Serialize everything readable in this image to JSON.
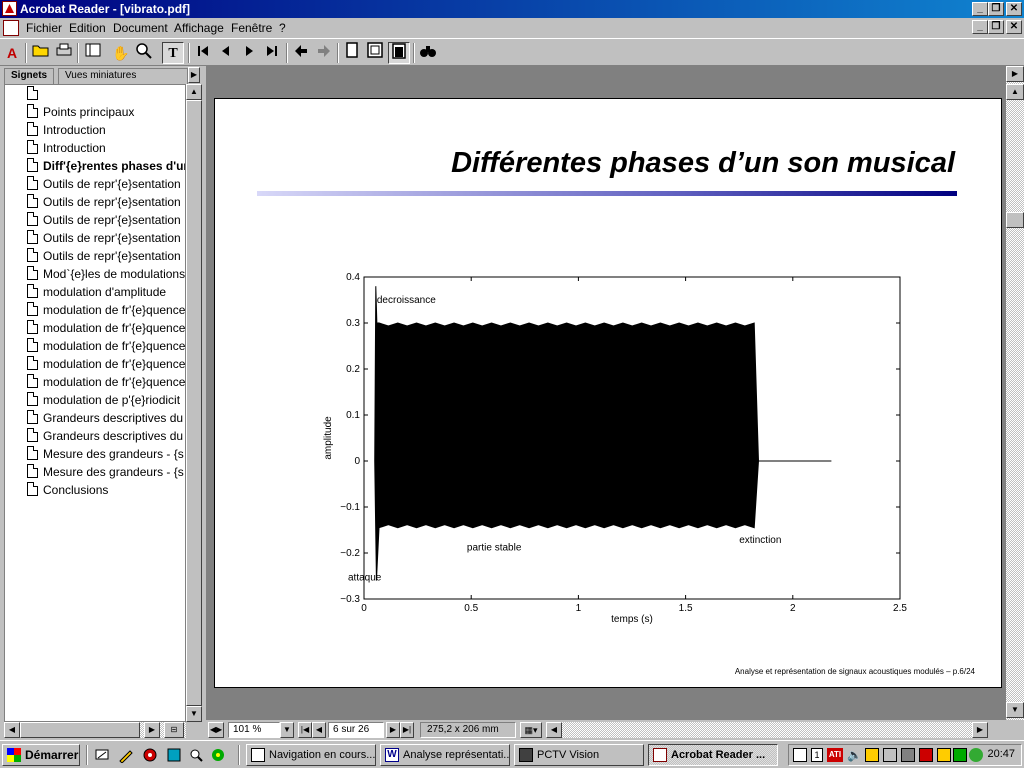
{
  "window": {
    "title": "Acrobat Reader - [vibrato.pdf]",
    "minimize": "_",
    "restore": "❐",
    "close": "✕"
  },
  "menu": {
    "items": [
      "Fichier",
      "Edition",
      "Document",
      "Affichage",
      "Fenêtre",
      "?"
    ]
  },
  "toolbar": {
    "icons": [
      "acrobat-icon",
      "open-icon",
      "print-icon",
      "bookmark-pane-icon",
      "hand-icon",
      "zoom-icon",
      "text-select-icon",
      "first-page-icon",
      "prev-page-icon",
      "next-page-icon",
      "last-page-icon",
      "go-back-icon",
      "go-forward-icon",
      "actual-size-icon",
      "fit-page-icon",
      "fit-width-icon",
      "find-icon"
    ]
  },
  "sidebar": {
    "tabs": [
      "Signets",
      "Vues miniatures"
    ],
    "bookmarks": [
      "",
      "Points principaux",
      "Introduction",
      "Introduction",
      "Diff'{e}rentes phases d'un",
      "Outils de repr'{e}sentation",
      "Outils de repr'{e}sentation",
      "Outils de repr'{e}sentation",
      "Outils de repr'{e}sentation",
      "Outils de repr'{e}sentation",
      "Mod`{e}les de modulations",
      "modulation d'amplitude",
      "modulation de fr'{e}quence",
      "modulation de fr'{e}quence",
      "modulation de fr'{e}quence",
      "modulation de fr'{e}quence",
      "modulation de fr'{e}quence",
      "modulation de p'{e}riodicit",
      "Grandeurs descriptives du",
      "Grandeurs descriptives du",
      "Mesure des grandeurs - {s",
      "Mesure des grandeurs - {s",
      "Conclusions"
    ],
    "current_index": 4
  },
  "slide": {
    "title": "Différentes phases d’un son musical",
    "footer": "Analyse et représentation de signaux acoustiques modulés – p.6/24"
  },
  "chart_data": {
    "type": "line",
    "xlabel": "temps (s)",
    "ylabel": "amplitude",
    "xlim": [
      0,
      2.5
    ],
    "ylim": [
      -0.3,
      0.4
    ],
    "xticks": [
      "0",
      "0.5",
      "1",
      "1.5",
      "2",
      "2.5"
    ],
    "yticks": [
      "0.4",
      "0.3",
      "0.2",
      "0.1",
      "0",
      "−0.1",
      "−0.2",
      "−0.3"
    ],
    "annotations": [
      "decroissance",
      "partie stable",
      "extinction",
      "attaque"
    ],
    "envelope": {
      "attack_start_s": 0.05,
      "attack_peak_max": 0.38,
      "attack_peak_min": -0.26,
      "stable_start_s": 0.07,
      "stable_end_s": 1.82,
      "stable_max": 0.3,
      "stable_min": -0.145,
      "extinction_end_s": 1.84,
      "silence_end_s": 2.18
    }
  },
  "statusbar": {
    "zoom": "101 %",
    "page": "6 sur 26",
    "page_size": "275,2 x 206 mm"
  },
  "taskbar": {
    "start": "Démarrer",
    "tasks": [
      "Navigation en cours...",
      "Analyse représentati...",
      "PCTV Vision",
      "Acrobat Reader ..."
    ],
    "active_index": 3,
    "clock": "20:47"
  }
}
